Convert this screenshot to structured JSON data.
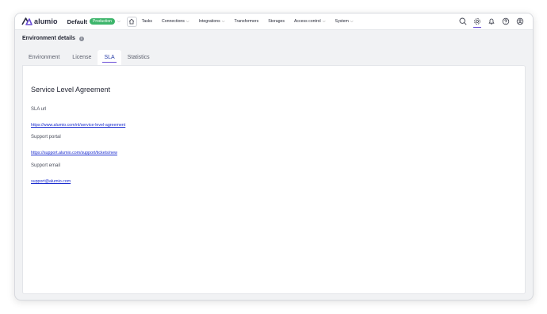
{
  "brand": {
    "name": "alumio",
    "accent": "#6b4fd6"
  },
  "environment": {
    "name": "Default",
    "badge": "Production",
    "badge_color": "#3db56b"
  },
  "nav": {
    "items": [
      {
        "label": "Tasks",
        "dropdown": false
      },
      {
        "label": "Connections",
        "dropdown": true
      },
      {
        "label": "Integrations",
        "dropdown": true
      },
      {
        "label": "Transformers",
        "dropdown": false
      },
      {
        "label": "Storages",
        "dropdown": false
      },
      {
        "label": "Access control",
        "dropdown": true
      },
      {
        "label": "System",
        "dropdown": true
      }
    ]
  },
  "header_icons": [
    "search-icon",
    "settings-gear-icon",
    "bell-icon",
    "help-icon",
    "user-icon"
  ],
  "page": {
    "title": "Environment details"
  },
  "tabs": [
    {
      "label": "Environment"
    },
    {
      "label": "License"
    },
    {
      "label": "SLA",
      "active": true
    },
    {
      "label": "Statistics"
    }
  ],
  "sla": {
    "title": "Service Level Agreement",
    "fields": [
      {
        "label": "SLA url",
        "value": "https://www.alumio.com/nl/service-level-agreement"
      },
      {
        "label": "Support portal",
        "value": "https://support.alumio.com/support/tickets/new"
      },
      {
        "label": "Support email",
        "value": "support@alumio.com"
      }
    ]
  }
}
